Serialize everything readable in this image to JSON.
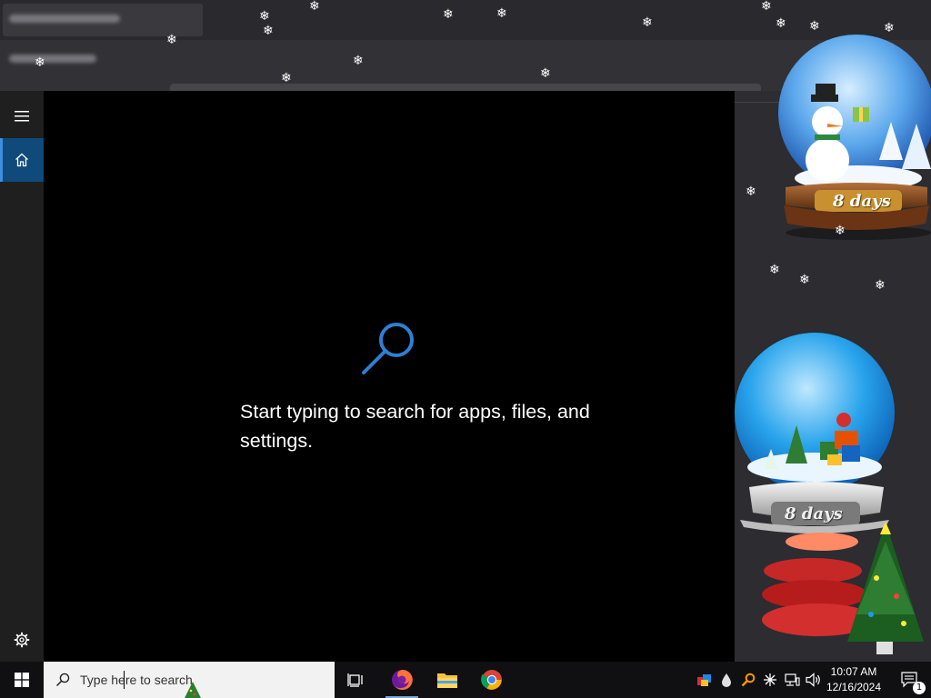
{
  "search_panel": {
    "empty_message": "Start typing to search for apps, files, and settings.",
    "rail": [
      "menu",
      "home",
      "settings"
    ]
  },
  "widgets": {
    "snowman_globe_countdown": "8 days",
    "blue_globe_countdown": "8 days"
  },
  "taskbar": {
    "search_placeholder": "Type here to search",
    "pinned_apps": [
      "task-view",
      "firefox",
      "file-explorer",
      "chrome"
    ],
    "tray_icons": [
      "app-tray",
      "droplet",
      "search-magnifier",
      "sparkle",
      "network",
      "volume"
    ],
    "clock": {
      "time": "10:07 AM",
      "date": "12/16/2024"
    },
    "notification_count": "1"
  },
  "colors": {
    "accent": "#0f4a7a",
    "search_icon": "#2d7fd3",
    "panel_background": "#000000",
    "rail_background": "#1f1f1f",
    "taskbar": "#101012"
  }
}
